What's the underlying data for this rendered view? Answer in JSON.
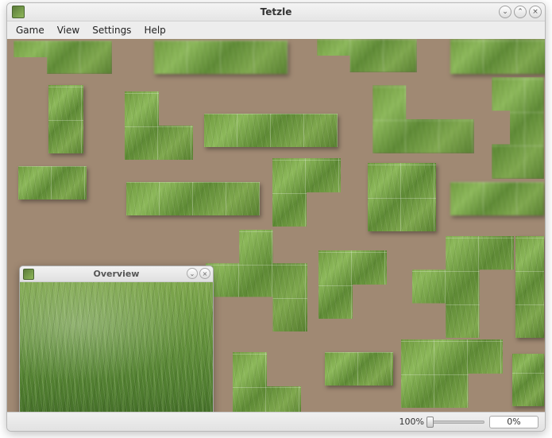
{
  "window": {
    "title": "Tetzle"
  },
  "menubar": {
    "items": [
      {
        "label": "Game",
        "underline": "G"
      },
      {
        "label": "View",
        "underline": "V"
      },
      {
        "label": "Settings",
        "underline": "S"
      },
      {
        "label": "Help",
        "underline": "H"
      }
    ]
  },
  "overview": {
    "title": "Overview"
  },
  "statusbar": {
    "zoom_percent": "100%",
    "progress_percent": "0%"
  },
  "colors": {
    "canvas_bg": "#a08973",
    "grass_light": "#8cb85a",
    "grass_dark": "#567e2f"
  }
}
